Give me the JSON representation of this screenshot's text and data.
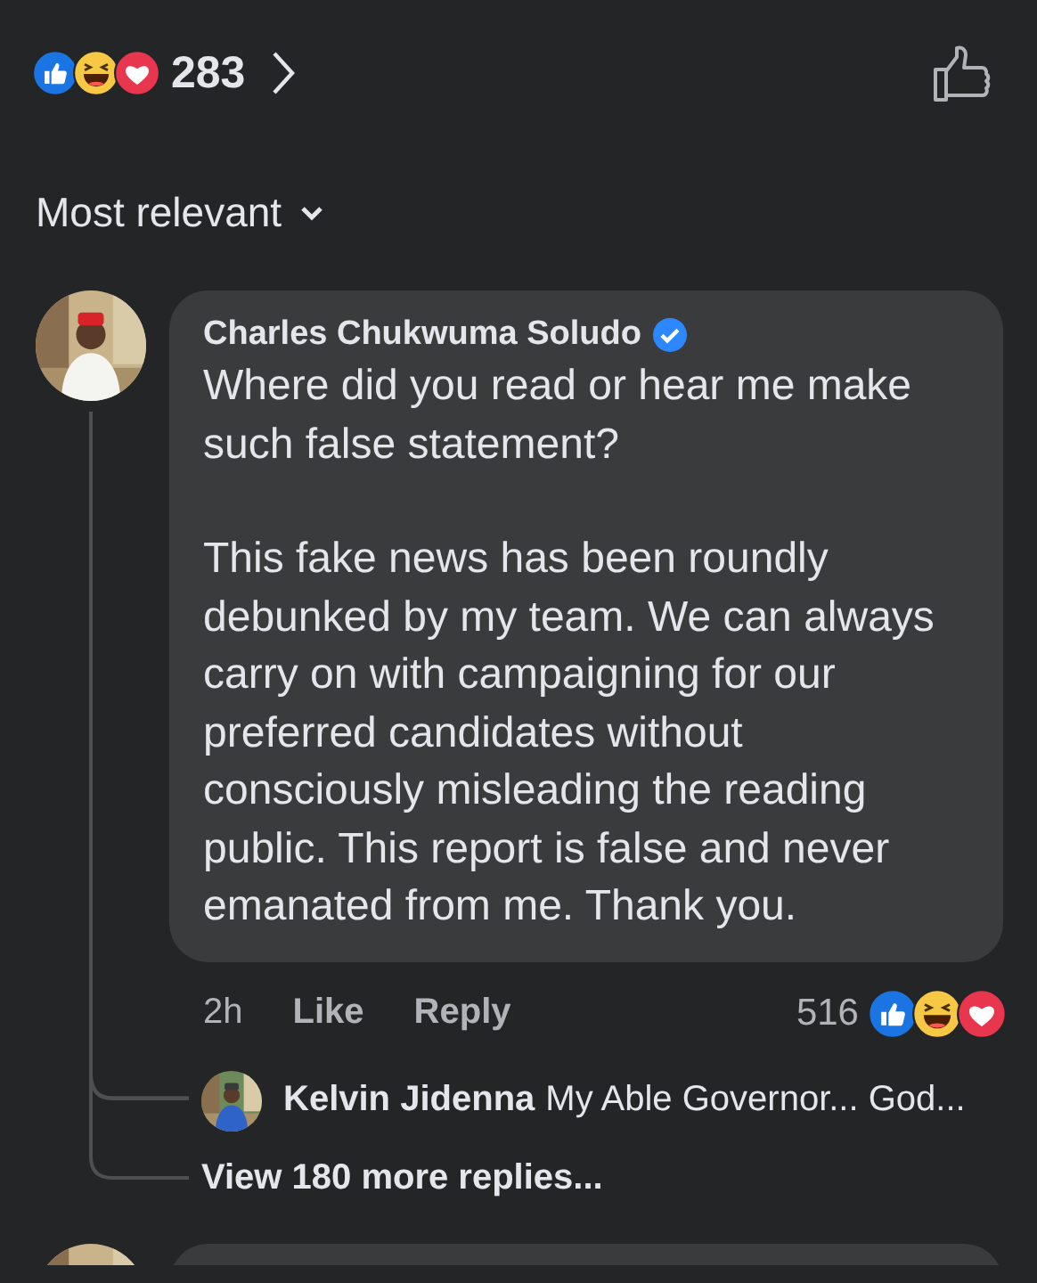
{
  "reactions": {
    "count": "283"
  },
  "sort": {
    "label": "Most relevant"
  },
  "comment": {
    "author": "Charles Chukwuma Soludo",
    "verified": true,
    "paragraphs": [
      "Where did you read or hear me make such false statement?",
      "This fake news has been roundly debunked by my team. We can always carry on with campaigning for our preferred candidates without consciously misleading the reading public. This report is false and never emanated from me. Thank you."
    ],
    "time": "2h",
    "actions": [
      "Like",
      "Reply"
    ],
    "reaction_count": "516",
    "replies": [
      {
        "author": "Kelvin Jidenna",
        "text": "My Able Governor... God..."
      }
    ],
    "more_replies": "View 180 more replies..."
  }
}
